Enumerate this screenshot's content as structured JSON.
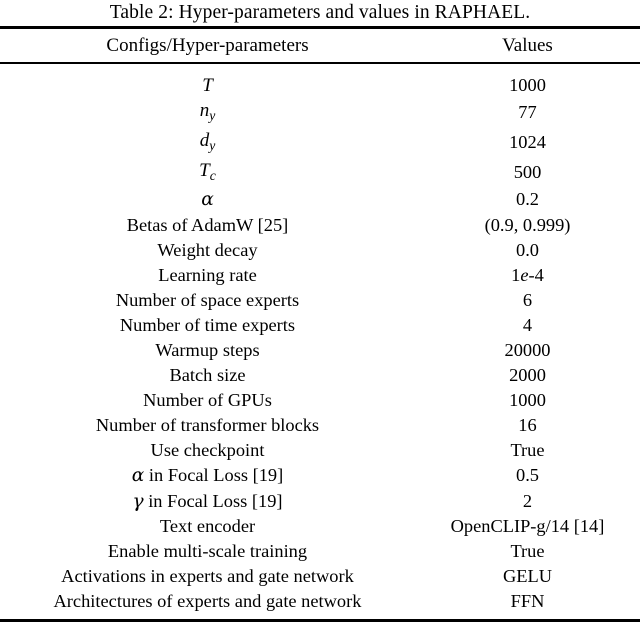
{
  "caption": {
    "label": "Table 2:",
    "text": "Table 2: Hyper-parameters and values in RAPHAEL."
  },
  "table": {
    "headers": {
      "config": "Configs/Hyper-parameters",
      "value": "Values"
    },
    "rows": [
      {
        "config": "T",
        "config_kind": "math",
        "value": "1000"
      },
      {
        "config": "n_y",
        "config_kind": "math-sub",
        "value": "77"
      },
      {
        "config": "d_y",
        "config_kind": "math-sub",
        "value": "1024"
      },
      {
        "config": "T_c",
        "config_kind": "math-sub",
        "value": "500"
      },
      {
        "config": "α",
        "config_kind": "greek",
        "value": "0.2"
      },
      {
        "config": "Betas of AdamW [25]",
        "config_kind": "text",
        "value": "(0.9, 0.999)"
      },
      {
        "config": "Weight decay",
        "config_kind": "text",
        "value": "0.0"
      },
      {
        "config": "Learning rate",
        "config_kind": "text",
        "value": "1e-4"
      },
      {
        "config": "Number of space experts",
        "config_kind": "text",
        "value": "6"
      },
      {
        "config": "Number of time experts",
        "config_kind": "text",
        "value": "4"
      },
      {
        "config": "Warmup steps",
        "config_kind": "text",
        "value": "20000"
      },
      {
        "config": "Batch size",
        "config_kind": "text",
        "value": "2000"
      },
      {
        "config": "Number of GPUs",
        "config_kind": "text",
        "value": "1000"
      },
      {
        "config": "Number of transformer blocks",
        "config_kind": "text",
        "value": "16"
      },
      {
        "config": "Use checkpoint",
        "config_kind": "text",
        "value": "True"
      },
      {
        "config": "α in Focal Loss [19]",
        "config_kind": "greek-text",
        "value": "0.5"
      },
      {
        "config": "γ in Focal Loss [19]",
        "config_kind": "greek-text",
        "value": "2"
      },
      {
        "config": "Text encoder",
        "config_kind": "text",
        "value": "OpenCLIP-g/14 [14]"
      },
      {
        "config": "Enable multi-scale training",
        "config_kind": "text",
        "value": "True"
      },
      {
        "config": "Activations in experts and gate network",
        "config_kind": "text",
        "value": "GELU"
      },
      {
        "config": "Architectures of experts and gate network",
        "config_kind": "text",
        "value": "FFN"
      }
    ]
  },
  "style": {
    "text_color": "#000000",
    "background_color": "#ffffff",
    "rule_color": "#000000"
  }
}
